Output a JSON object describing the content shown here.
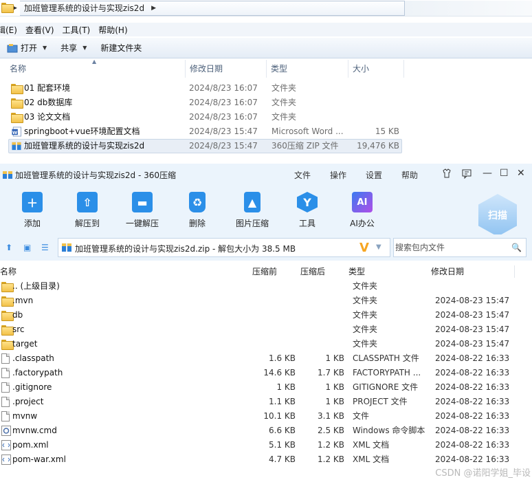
{
  "explorer": {
    "path": "加班管理系统的设计与实现zis2d",
    "menu": [
      "辑(E)",
      "查看(V)",
      "工具(T)",
      "帮助(H)"
    ],
    "toolbar": {
      "open": "打开",
      "share": "共享",
      "new_folder": "新建文件夹"
    },
    "columns": {
      "name": "名称",
      "date": "修改日期",
      "type": "类型",
      "size": "大小"
    },
    "files": [
      {
        "name": "01 配套环境",
        "date": "2024/8/23 16:07",
        "type": "文件夹",
        "size": "",
        "icon": "folder-icon"
      },
      {
        "name": "02 db数据库",
        "date": "2024/8/23 16:07",
        "type": "文件夹",
        "size": "",
        "icon": "folder-icon"
      },
      {
        "name": "03 论文文档",
        "date": "2024/8/23 16:07",
        "type": "文件夹",
        "size": "",
        "icon": "folder-icon"
      },
      {
        "name": "springboot+vue环境配置文档",
        "date": "2024/8/23 15:47",
        "type": "Microsoft Word ...",
        "size": "15 KB",
        "icon": "word-icon"
      },
      {
        "name": "加班管理系统的设计与实现zis2d",
        "date": "2024/8/23 15:47",
        "type": "360压缩 ZIP 文件",
        "size": "19,476 KB",
        "icon": "zip-icon"
      }
    ]
  },
  "zip": {
    "title": "加班管理系统的设计与实现zis2d - 360压缩",
    "menu": [
      "文件",
      "操作",
      "设置",
      "帮助"
    ],
    "tools": [
      {
        "label": "添加",
        "icon": "add-icon",
        "color": "#2b8fe8"
      },
      {
        "label": "解压到",
        "icon": "extract-to-icon",
        "color": "#2b8fe8"
      },
      {
        "label": "一键解压",
        "icon": "one-click-extract-icon",
        "color": "#2b8fe8"
      },
      {
        "label": "删除",
        "icon": "recycle-icon",
        "color": "#2b8fe8"
      },
      {
        "label": "图片压缩",
        "icon": "image-compress-icon",
        "color": "#2b8fe8"
      },
      {
        "label": "工具",
        "icon": "tools-icon",
        "color": "#2b8fe8"
      },
      {
        "label": "AI办公",
        "icon": "ai-office-icon",
        "color": "#8a4ee8"
      }
    ],
    "scan_label": "扫描",
    "path_text": "加班管理系统的设计与实现zis2d.zip - 解包大小为 38.5 MB",
    "search_placeholder": "搜索包内文件",
    "columns": {
      "name": "名称",
      "orig": "压缩前",
      "comp": "压缩后",
      "type": "类型",
      "date": "修改日期"
    },
    "files": [
      {
        "name": ".. (上级目录)",
        "orig": "",
        "comp": "",
        "type": "文件夹",
        "date": "",
        "icon": "folder-icon"
      },
      {
        "name": ".mvn",
        "orig": "",
        "comp": "",
        "type": "文件夹",
        "date": "2024-08-23 15:47",
        "icon": "folder-icon"
      },
      {
        "name": "db",
        "orig": "",
        "comp": "",
        "type": "文件夹",
        "date": "2024-08-23 15:47",
        "icon": "folder-icon"
      },
      {
        "name": "src",
        "orig": "",
        "comp": "",
        "type": "文件夹",
        "date": "2024-08-23 15:47",
        "icon": "folder-icon"
      },
      {
        "name": "target",
        "orig": "",
        "comp": "",
        "type": "文件夹",
        "date": "2024-08-23 15:47",
        "icon": "folder-icon"
      },
      {
        "name": ".classpath",
        "orig": "1.6 KB",
        "comp": "1 KB",
        "type": "CLASSPATH 文件",
        "date": "2024-08-22 16:33",
        "icon": "file-icon"
      },
      {
        "name": ".factorypath",
        "orig": "14.6 KB",
        "comp": "1.7 KB",
        "type": "FACTORYPATH ...",
        "date": "2024-08-22 16:33",
        "icon": "file-icon"
      },
      {
        "name": ".gitignore",
        "orig": "1 KB",
        "comp": "1 KB",
        "type": "GITIGNORE 文件",
        "date": "2024-08-22 16:33",
        "icon": "file-icon"
      },
      {
        "name": ".project",
        "orig": "1.1 KB",
        "comp": "1 KB",
        "type": "PROJECT 文件",
        "date": "2024-08-22 16:33",
        "icon": "file-icon"
      },
      {
        "name": "mvnw",
        "orig": "10.1 KB",
        "comp": "3.1 KB",
        "type": "文件",
        "date": "2024-08-22 16:33",
        "icon": "file-icon"
      },
      {
        "name": "mvnw.cmd",
        "orig": "6.6 KB",
        "comp": "2.5 KB",
        "type": "Windows 命令脚本",
        "date": "2024-08-22 16:33",
        "icon": "cmd-icon"
      },
      {
        "name": "pom.xml",
        "orig": "5.1 KB",
        "comp": "1.2 KB",
        "type": "XML 文档",
        "date": "2024-08-22 16:33",
        "icon": "xml-icon"
      },
      {
        "name": "pom-war.xml",
        "orig": "4.7 KB",
        "comp": "1.2 KB",
        "type": "XML 文档",
        "date": "2024-08-22 16:33",
        "icon": "xml-icon"
      }
    ]
  },
  "watermark": "CSDN @诺阳学姐_毕设"
}
